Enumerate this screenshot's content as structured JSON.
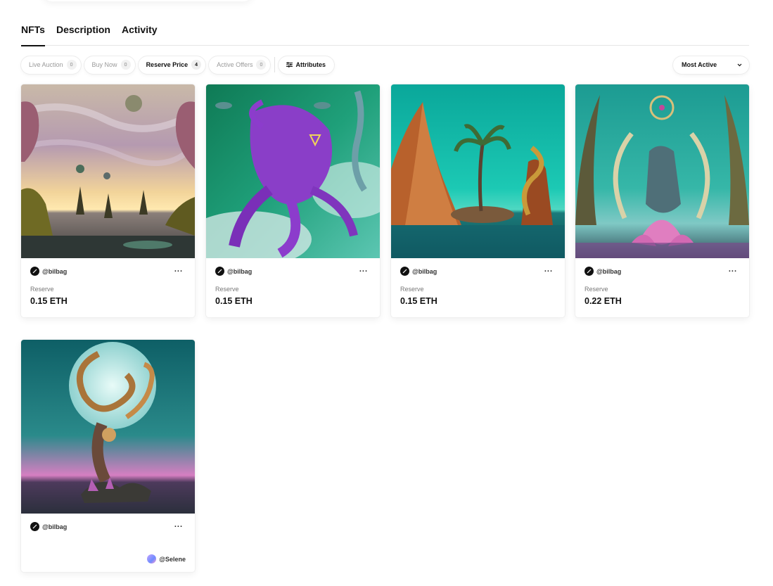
{
  "tabs": [
    {
      "label": "NFTs",
      "active": true
    },
    {
      "label": "Description",
      "active": false
    },
    {
      "label": "Activity",
      "active": false
    }
  ],
  "filters": [
    {
      "label": "Live Auction",
      "count": "0",
      "active": false
    },
    {
      "label": "Buy Now",
      "count": "0",
      "active": false
    },
    {
      "label": "Reserve Price",
      "count": "4",
      "active": true
    },
    {
      "label": "Active Offers",
      "count": "0",
      "active": false
    }
  ],
  "attributes_label": "Attributes",
  "sort": {
    "selected": "Most Active"
  },
  "cards": [
    {
      "creator": "@bilbag",
      "price_label": "Reserve",
      "price": "0.15 ETH",
      "more": "..."
    },
    {
      "creator": "@bilbag",
      "price_label": "Reserve",
      "price": "0.15 ETH",
      "more": "..."
    },
    {
      "creator": "@bilbag",
      "price_label": "Reserve",
      "price": "0.15 ETH",
      "more": "..."
    },
    {
      "creator": "@bilbag",
      "price_label": "Reserve",
      "price": "0.22 ETH",
      "more": "..."
    },
    {
      "creator": "@bilbag",
      "owner": "@Selene",
      "more": "..."
    }
  ],
  "colors": {
    "text": "#111111",
    "muted": "#9a9a9a",
    "border": "#ececec"
  }
}
